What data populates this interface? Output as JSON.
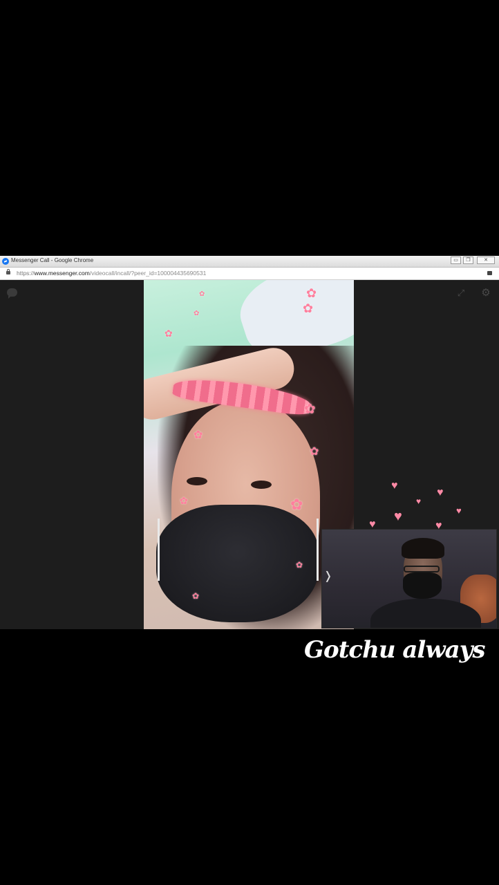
{
  "window": {
    "title": "Messenger Call - Google Chrome",
    "controls": {
      "minimize": "▭",
      "restore": "❐",
      "close": "✕"
    }
  },
  "address_bar": {
    "url_scheme": "https://",
    "url_host": "www.messenger.com",
    "url_path": "/videocall/incall/?peer_id=100004435690531"
  },
  "call": {
    "icons": [
      "chat-icon",
      "expand-icon",
      "settings-icon",
      "collapse-toggle-icon"
    ],
    "expand_glyph": "⤢",
    "settings_glyph": "⚙",
    "collapse_glyph": "❭"
  },
  "overlay": {
    "caption": "Gotchu always",
    "accent_color": "#ff8aa6"
  }
}
